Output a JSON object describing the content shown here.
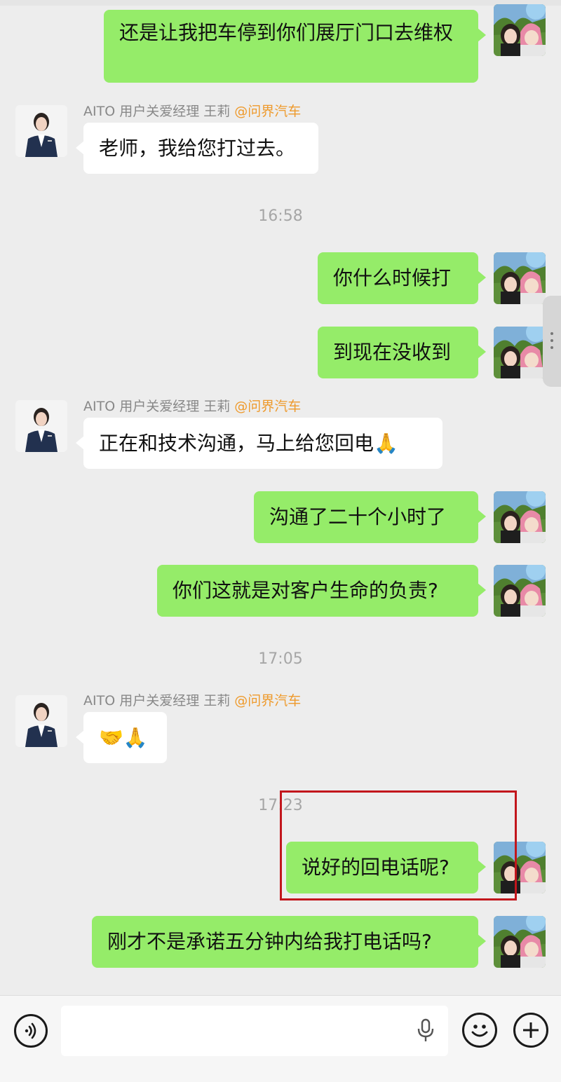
{
  "sender_name": "AITO 用户关爱经理 王莉",
  "sender_org": "@问界汽车",
  "messages": {
    "m1": "还是让我把车停到你们展厅门口去维权",
    "m2": "老师，我给您打过去。",
    "t1": "16:58",
    "m3": "你什么时候打",
    "m4": "到现在没收到",
    "m5": "正在和技术沟通，马上给您回电🙏",
    "m6": "沟通了二十个小时了",
    "m7": "你们这就是对客户生命的负责?",
    "t2": "17:05",
    "m8": "🤝🙏",
    "t3": "17:23",
    "m9": "说好的回电话呢?",
    "m10": "刚才不是承诺五分钟内给我打电话吗?"
  },
  "input_bar": {
    "voice_icon": "voice-mode-icon",
    "mic_icon": "microphone-icon",
    "emoji_icon": "emoji-icon",
    "plus_icon": "plus-icon"
  },
  "colors": {
    "my_bubble": "#95ec69",
    "their_bubble": "#ffffff",
    "background": "#ededed",
    "org_tag": "#ee9a2c",
    "highlight_box": "#c2161c"
  }
}
